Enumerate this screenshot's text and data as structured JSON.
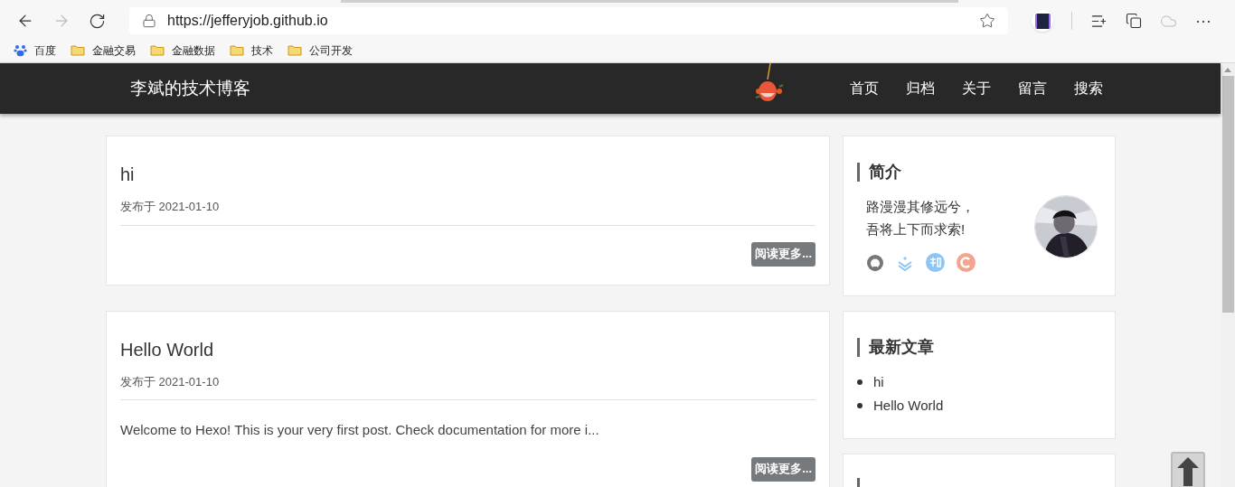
{
  "browser": {
    "url": "https://jefferyjob.github.io",
    "bookmarks": [
      {
        "kind": "site",
        "label": "百度"
      },
      {
        "kind": "folder",
        "label": "金融交易"
      },
      {
        "kind": "folder",
        "label": "金融数据"
      },
      {
        "kind": "folder",
        "label": "技术"
      },
      {
        "kind": "folder",
        "label": "公司开发"
      }
    ],
    "toolbar_more": "···"
  },
  "site": {
    "title": "李斌的技术博客",
    "nav": [
      "首页",
      "归档",
      "关于",
      "留言",
      "搜索"
    ]
  },
  "posts": [
    {
      "title": "hi",
      "meta": "发布于 2021-01-10",
      "button": "阅读更多..."
    },
    {
      "title": "Hello World",
      "meta": "发布于 2021-01-10",
      "excerpt": "Welcome to Hexo! This is your very first post. Check documentation for more i...",
      "button": "阅读更多..."
    }
  ],
  "sidebar": {
    "intro": {
      "title": "简介",
      "lines": [
        "路漫漫其修远兮，",
        "吾将上下而求索!"
      ],
      "socials": [
        {
          "kind": "github",
          "color": "#777777"
        },
        {
          "kind": "juejin",
          "color": "#8ec5f5"
        },
        {
          "kind": "zhihu",
          "color": "#8ec5f5"
        },
        {
          "kind": "csdn",
          "color": "#f4a48e"
        }
      ]
    },
    "recent": {
      "title": "最新文章",
      "items": [
        "hi",
        "Hello World"
      ]
    },
    "third_card": {
      "kind": "cut"
    }
  }
}
